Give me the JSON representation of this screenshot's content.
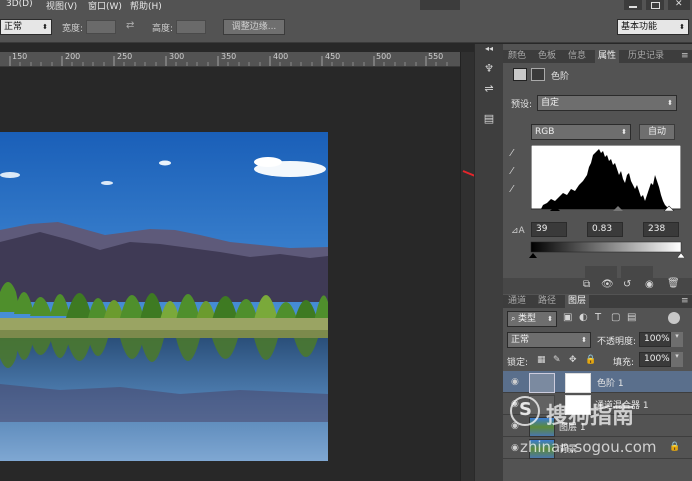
{
  "menubar": {
    "items": [
      "3D(D)",
      "视图(V)",
      "窗口(W)",
      "帮助(H)"
    ]
  },
  "options": {
    "mode_value": "正常",
    "width_label": "宽度:",
    "height_label": "高度:",
    "refine_edge_button": "调整边缘...",
    "workspace_value": "基本功能"
  },
  "ruler": {
    "labels": [
      "150",
      "200",
      "250",
      "300",
      "350",
      "400",
      "450",
      "500",
      "550"
    ]
  },
  "panel": {
    "top_tabs": [
      "颜色",
      "色板",
      "信息",
      "属性",
      "历史记录"
    ],
    "active_top_tab": "属性",
    "properties_title": "色阶",
    "preset_label": "预设:",
    "preset_value": "自定",
    "channel_value": "RGB",
    "auto_button": "自动",
    "input_shadow": "39",
    "input_gamma": "0.83",
    "input_highlight": "238",
    "layer_tabs": [
      "通道",
      "路径",
      "图层"
    ],
    "active_layer_tab": "图层",
    "kind_value": "类型",
    "blend_value": "正常",
    "opacity_label": "不透明度:",
    "opacity_value": "100%",
    "lock_label": "锁定:",
    "fill_label": "填充:",
    "fill_value": "100%",
    "layers": [
      {
        "name": "色阶 1",
        "selected": true
      },
      {
        "name": "通道混合器 1",
        "selected": false
      },
      {
        "name": "图层 1",
        "selected": false
      },
      {
        "name": "背景",
        "selected": false
      }
    ]
  },
  "watermark": {
    "brand": "搜狗指南",
    "url": "zhinan.sogou.com"
  },
  "colors": {
    "accent_tab": "#535353",
    "selected_layer": "#5a6f8c",
    "annotation_arrow": "#e5252b"
  }
}
